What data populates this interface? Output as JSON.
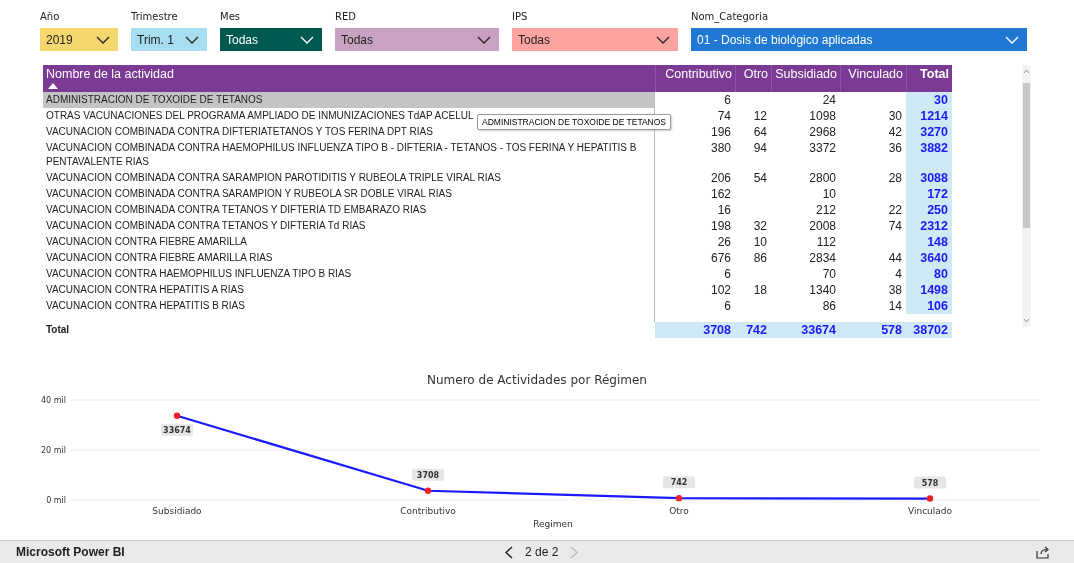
{
  "filters": [
    {
      "label": "Año",
      "value": "2019",
      "color": "#f5d76e"
    },
    {
      "label": "Trimestre",
      "value": "Trim. 1",
      "color": "#a6ddf0"
    },
    {
      "label": "Mes",
      "value": "Todas",
      "color": "#005a50"
    },
    {
      "label": "RED",
      "value": "Todas",
      "color": "#c8a2c0"
    },
    {
      "label": "IPS",
      "value": "Todas",
      "color": "#fba4a0"
    },
    {
      "label": "Nom_Categoria",
      "value": "01 - Dosis de biológico aplicadas",
      "color": "#1e78d4"
    }
  ],
  "table": {
    "columns": [
      {
        "label": "Nombre de la actividad",
        "sorted": true
      },
      {
        "label": "Contributivo",
        "sorted": false
      },
      {
        "label": "Otro",
        "sorted": false
      },
      {
        "label": "Subsidiado",
        "sorted": false
      },
      {
        "label": "Vinculado",
        "sorted": false
      },
      {
        "label": "Total",
        "sorted": false
      }
    ],
    "rows": [
      {
        "name": "ADMINISTRACION DE TOXOIDE DE TETANOS",
        "contributivo": "6",
        "subsidiado": "24",
        "total": "30",
        "selected": true
      },
      {
        "name": "OTRAS VACUNACIONES DEL PROGRAMA AMPLIADO DE INMUNIZACIONES TdAP ACELUL",
        "contributivo": "74",
        "otro": "12",
        "subsidiado": "1098",
        "vinculado": "30",
        "total": "1214",
        "selected": false
      },
      {
        "name": "VACUNACION COMBINADA CONTRA DIFTERIATETANOS Y TOS FERINA DPT RIAS",
        "contributivo": "196",
        "otro": "64",
        "subsidiado": "2968",
        "vinculado": "42",
        "total": "3270",
        "selected": false
      },
      {
        "name": "VACUNACION COMBINADA CONTRA HAEMOPHILUS INFLUENZA TIPO B - DIFTERIA - TETANOS - TOS FERINA Y HEPATITIS B PENTAVALENTE RIAS",
        "contributivo": "380",
        "otro": "94",
        "subsidiado": "3372",
        "vinculado": "36",
        "total": "3882",
        "selected": false
      },
      {
        "name": "VACUNACION COMBINADA CONTRA SARAMPION PAROTIDITIS Y RUBEOLA TRIPLE VIRAL RIAS",
        "contributivo": "206",
        "otro": "54",
        "subsidiado": "2800",
        "vinculado": "28",
        "total": "3088",
        "selected": false
      },
      {
        "name": "VACUNACION COMBINADA CONTRA SARAMPION Y RUBEOLA SR DOBLE VIRAL RIAS",
        "contributivo": "162",
        "subsidiado": "10",
        "total": "172",
        "selected": false
      },
      {
        "name": "VACUNACION COMBINADA CONTRA TETANOS Y DIFTERIA TD EMBARAZO RIAS",
        "contributivo": "16",
        "subsidiado": "212",
        "vinculado": "22",
        "total": "250",
        "selected": false
      },
      {
        "name": "VACUNACION COMBINADA CONTRA TETANOS Y DIFTERIA Td RIAS",
        "contributivo": "198",
        "otro": "32",
        "subsidiado": "2008",
        "vinculado": "74",
        "total": "2312",
        "selected": false
      },
      {
        "name": "VACUNACION CONTRA FIEBRE AMARILLA",
        "contributivo": "26",
        "otro": "10",
        "subsidiado": "112",
        "total": "148",
        "selected": false
      },
      {
        "name": "VACUNACION CONTRA FIEBRE AMARILLA RIAS",
        "contributivo": "676",
        "otro": "86",
        "subsidiado": "2834",
        "vinculado": "44",
        "total": "3640",
        "selected": false
      },
      {
        "name": "VACUNACION CONTRA HAEMOPHILUS INFLUENZA TIPO B RIAS",
        "contributivo": "6",
        "subsidiado": "70",
        "vinculado": "4",
        "total": "80",
        "selected": false
      },
      {
        "name": "VACUNACION CONTRA HEPATITIS A RIAS",
        "contributivo": "102",
        "otro": "18",
        "subsidiado": "1340",
        "vinculado": "38",
        "total": "1498",
        "selected": false
      },
      {
        "name": "VACUNACION CONTRA HEPATITIS B RIAS",
        "contributivo": "6",
        "subsidiado": "86",
        "vinculado": "14",
        "total": "106",
        "selected": false
      }
    ],
    "totals": {
      "label": "Total",
      "contributivo": "3708",
      "otro": "742",
      "subsidiado": "33674",
      "vinculado": "578",
      "total": "38702"
    },
    "tooltip": "ADMINISTRACION DE TOXOIDE DE TETANOS"
  },
  "chart": {
    "chart_data": {
      "type": "line",
      "title": "Numero de Actividades por Régimen",
      "xlabel": "Regimen",
      "categories": [
        "Subsidiado",
        "Contributivo",
        "Otro",
        "Vinculado"
      ],
      "series": [
        {
          "color": "#1a1aff",
          "marker": true,
          "values": [
            33.7,
            3.7,
            0.74,
            0.58
          ]
        }
      ],
      "ylim": [
        0,
        40
      ],
      "yticks": [
        {
          "value": 0,
          "label": "0 mil"
        },
        {
          "value": 20,
          "label": "20 mil"
        },
        {
          "value": 40,
          "label": "40 mil"
        }
      ],
      "value_labels": [
        "33674",
        "3708",
        "742",
        "578"
      ]
    }
  },
  "footer": {
    "brand": "Microsoft Power BI",
    "page": "2 de 2"
  }
}
